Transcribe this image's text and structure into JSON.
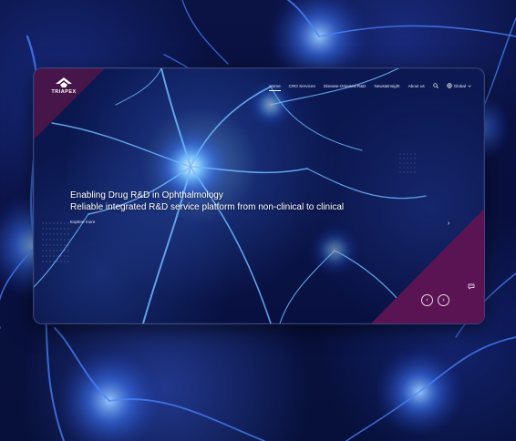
{
  "logo": {
    "text": "TRIAPEX",
    "icon": "triapex-logo"
  },
  "nav": {
    "items": [
      {
        "label": "Home",
        "active": true
      },
      {
        "label": "CRO Services",
        "active": false
      },
      {
        "label": "Disease-Oriented R&D",
        "active": false
      },
      {
        "label": "News&Insight",
        "active": false
      },
      {
        "label": "About us",
        "active": false
      }
    ],
    "search_icon": "search-icon",
    "global_label": "Global",
    "global_icon": "globe-icon"
  },
  "hero": {
    "title_line1": "Enabling Drug R&D in Ophthalmology",
    "title_line2": "Reliable integrated R&D service platform from non-clinical to clinical",
    "explore_label": "Explore more",
    "next_arrow": "›"
  },
  "slider": {
    "prev": "‹",
    "next": "›"
  },
  "colors": {
    "background": "#0a1448",
    "accent_maroon": "#5a1454",
    "neuron_glow": "#4fa8ff"
  }
}
